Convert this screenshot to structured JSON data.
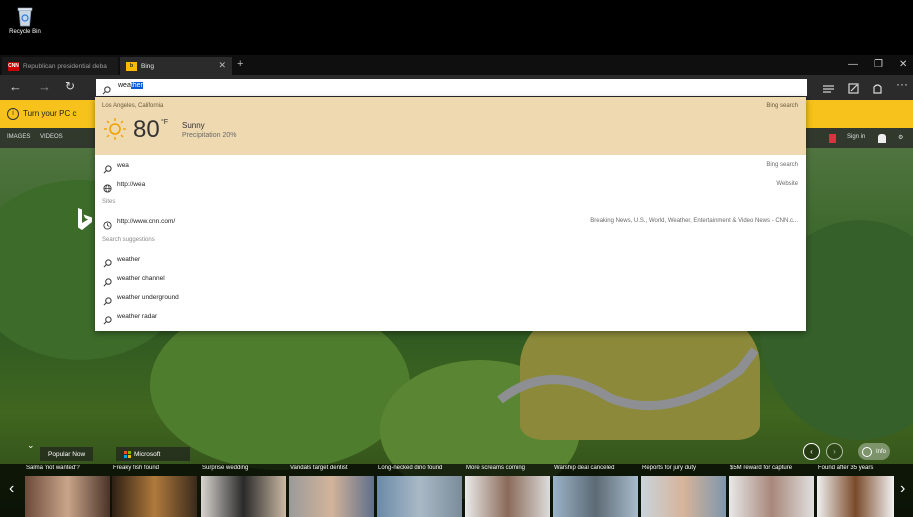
{
  "desktop": {
    "recycle_bin_label": "Recycle Bin"
  },
  "tabs": [
    {
      "title": "Republican presidential deba",
      "icon": "cnn-favicon",
      "favicon_text": "CNN"
    },
    {
      "title": "Bing",
      "icon": "bing-favicon",
      "favicon_text": "b"
    }
  ],
  "address_bar": {
    "typed": "wea",
    "autocomplete": "ther"
  },
  "notification": {
    "text": "Turn your PC c"
  },
  "bing_nav": {
    "items": [
      "IMAGES",
      "VIDEOS"
    ],
    "signin": "Sign in"
  },
  "weather": {
    "location": "Los Angeles, California",
    "source": "Bing search",
    "temperature": "80",
    "unit": "°F",
    "condition": "Sunny",
    "precipitation": "Precipitation 20%"
  },
  "suggestions": {
    "top": [
      {
        "text": "wea",
        "right": "Bing search",
        "icon": "search-icon"
      },
      {
        "text": "http://wea",
        "right": "Website",
        "icon": "globe-icon"
      }
    ],
    "sites_heading": "Sites",
    "sites": [
      {
        "text": "http://www.cnn.com/",
        "right": "Breaking News, U.S., World, Weather, Entertainment & Video News - CNN.c...",
        "icon": "history-icon"
      }
    ],
    "suggestions_heading": "Search suggestions",
    "search_suggestions": [
      "weather",
      "weather channel",
      "weather underground",
      "weather radar"
    ]
  },
  "carousel": {
    "tabs": [
      "Popular Now",
      "Microsoft"
    ],
    "info_label": "Info",
    "news": [
      "Salma 'not wanted'?",
      "Freaky fish found",
      "Surprise wedding",
      "Vandals target dentist",
      "Long-necked dino found",
      "More screams coming",
      "Warship deal canceled",
      "Reports for jury duty",
      "$5M reward for capture",
      "Found after 35 years"
    ]
  },
  "colors": {
    "notification_bg": "#f7c21b",
    "weather_card_bg": "#eed9b0",
    "selection": "#0a5bd3"
  }
}
